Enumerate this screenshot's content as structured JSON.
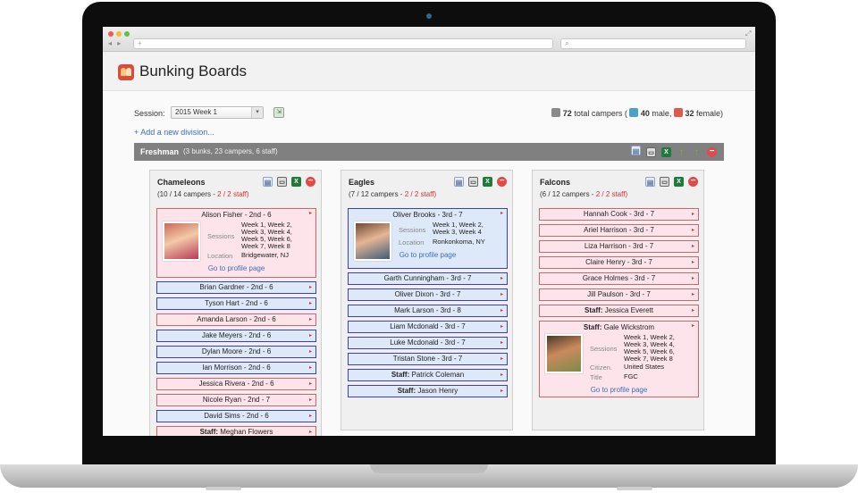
{
  "browser": {
    "url_placeholder": "+",
    "search_placeholder": ""
  },
  "app": {
    "title": "Bunking Boards"
  },
  "toolbar": {
    "session_label": "Session:",
    "session_value": "2015 Week 1",
    "totals": {
      "total": "72",
      "total_label": "total campers (",
      "male": "40",
      "male_label": "male,",
      "female": "32",
      "female_label": "female)"
    },
    "add_division": "+ Add a new division..."
  },
  "division": {
    "name": "Freshman",
    "meta": "(3 bunks, 23 campers, 6 staff)"
  },
  "bunks": [
    {
      "title": "Chameleons",
      "count": "(10 / 14 campers -",
      "staff": "2 / 2 staff)",
      "featured": {
        "name": "Alison Fisher - 2nd - 6",
        "k1": "Sessions",
        "v1": [
          "Week 1, Week 2,",
          "Week 3, Week 4,",
          "Week 5, Week 6,",
          "Week 7, Week 8"
        ],
        "k2": "Location",
        "v2": "Bridgewater, NJ",
        "link": "Go to profile page"
      },
      "rows": [
        {
          "label": "Brian Gardner - 2nd - 6",
          "g": "m"
        },
        {
          "label": "Tyson Hart - 2nd - 6",
          "g": "m"
        },
        {
          "label": "Amanda Larson - 2nd - 6",
          "g": "f"
        },
        {
          "label": "Jake Meyers - 2nd - 6",
          "g": "m"
        },
        {
          "label": "Dylan Moore - 2nd - 6",
          "g": "m"
        },
        {
          "label": "Ian Morrison - 2nd - 6",
          "g": "m"
        },
        {
          "label": "Jessica Rivera - 2nd - 6",
          "g": "f"
        },
        {
          "label": "Nicole Ryan - 2nd - 7",
          "g": "f"
        },
        {
          "label": "David Sims - 2nd - 6",
          "g": "m"
        }
      ],
      "staff_row": {
        "prefix": "Staff:",
        "name": "Meghan Flowers"
      }
    },
    {
      "title": "Eagles",
      "count": "(7 / 12 campers -",
      "staff": "2 / 2 staff)",
      "featured": {
        "name": "Oliver Brooks - 3rd - 7",
        "k1": "Sessions",
        "v1": [
          "Week 1, Week 2,",
          "Week 3, Week 4"
        ],
        "k2": "Location",
        "v2": "Ronkonkoma, NY",
        "link": "Go to profile page"
      },
      "rows": [
        {
          "label": "Garth Cunningham - 3rd - 7",
          "g": "m"
        },
        {
          "label": "Oliver Dixon - 3rd - 7",
          "g": "m"
        },
        {
          "label": "Mark Larson - 3rd - 8",
          "g": "m"
        },
        {
          "label": "Liam Mcdonald - 3rd - 7",
          "g": "m"
        },
        {
          "label": "Luke Mcdonald - 3rd - 7",
          "g": "m"
        },
        {
          "label": "Tristan Stone - 3rd - 7",
          "g": "m"
        }
      ],
      "staff_rows": [
        {
          "prefix": "Staff:",
          "name": "Patrick Coleman"
        },
        {
          "prefix": "Staff:",
          "name": "Jason Henry"
        }
      ]
    },
    {
      "title": "Falcons",
      "count": "(6 / 12 campers -",
      "staff": "2 / 2 staff)",
      "rows": [
        {
          "label": "Hannah Cook - 3rd - 7",
          "g": "f"
        },
        {
          "label": "Ariel Harrison - 3rd - 7",
          "g": "f"
        },
        {
          "label": "Liza Harrison - 3rd - 7",
          "g": "f"
        },
        {
          "label": "Claire Henry - 3rd - 7",
          "g": "f"
        },
        {
          "label": "Grace Holmes - 3rd - 7",
          "g": "f"
        },
        {
          "label": "Jill Paulson - 3rd - 7",
          "g": "f"
        }
      ],
      "staff_row": {
        "prefix": "Staff:",
        "name": "Jessica Everett"
      },
      "featured": {
        "prefix": "Staff:",
        "name": "Gale Wickstrom",
        "k1": "Sessions",
        "v1": [
          "Week 1, Week 2,",
          "Week 3, Week 4,",
          "Week 5, Week 6,",
          "Week 7, Week 8"
        ],
        "k2": "Citizen.",
        "v2": "United States",
        "k3": "Title",
        "v3": "FGC",
        "link": "Go to profile page"
      }
    }
  ],
  "colors": {
    "female_bg": "#fce4ea",
    "female_border": "#d6606d",
    "male_bg": "#dde9f8",
    "male_border": "#3e3fb8",
    "division_bar": "#808080",
    "link": "#3b6fb6",
    "staff_count": "#dd3333"
  },
  "icons": [
    "export-icon",
    "person-icon",
    "male-icon",
    "female-icon",
    "card-icon",
    "print-icon",
    "excel-icon",
    "up-arrow-icon",
    "remove-icon",
    "caret-icon"
  ]
}
